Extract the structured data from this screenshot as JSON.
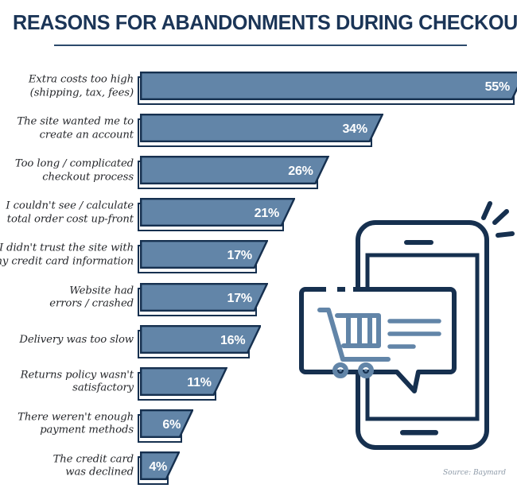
{
  "header": {
    "title": "REASONS FOR ABANDONMENTS DURING CHECKOUT"
  },
  "footer": {
    "source": "Source: Baymard"
  },
  "theme": {
    "title_color": "#1b3557",
    "bar_fill": "#6285a8",
    "bar_outline": "#16304f",
    "value_text": "#ffffff",
    "label_text": "#25272b",
    "illustration_navy": "#16304f",
    "illustration_blue": "#6285a8",
    "source_color": "#8d9aa8",
    "background": "#ffffff"
  },
  "illustration": {
    "name": "smartphone-cart-chat-illustration",
    "parts": [
      "phone-outline",
      "phone-screen",
      "phone-speaker",
      "phone-home-bar",
      "speech-bubble",
      "shopping-cart-icon",
      "text-lines",
      "sparkle-lines"
    ]
  },
  "chart_data": {
    "type": "bar",
    "orientation": "horizontal",
    "title": "REASONS FOR ABANDONMENTS DURING CHECKOUT",
    "xlabel": "",
    "ylabel": "",
    "xlim": [
      0,
      55
    ],
    "grid": false,
    "legend": null,
    "value_suffix": "%",
    "source": "Source: Baymard",
    "categories": [
      "Extra costs too high\n(shipping, tax, fees)",
      "The site wanted me to\ncreate an account",
      "Too long / complicated\ncheckout process",
      "I couldn't see / calculate\ntotal order cost up-front",
      "I didn't trust the site with\nmy credit card information",
      "Website had\nerrors / crashed",
      "Delivery was too slow",
      "Returns policy wasn't\nsatisfactory",
      "There weren't enough\npayment methods",
      "The credit card\nwas declined"
    ],
    "values": [
      55,
      34,
      26,
      21,
      17,
      17,
      16,
      11,
      6,
      4
    ],
    "value_labels": [
      "55%",
      "34%",
      "26%",
      "21%",
      "17%",
      "17%",
      "16%",
      "11%",
      "6%",
      "4%"
    ]
  }
}
